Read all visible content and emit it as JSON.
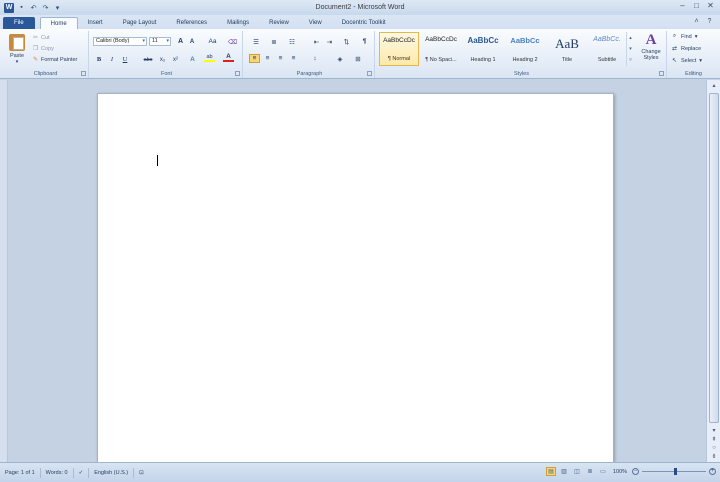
{
  "window": {
    "title": "Document2 - Microsoft Word",
    "logo_letter": "W",
    "controls": [
      "–",
      "□",
      "✕"
    ]
  },
  "qat": {
    "save_icon": "save-icon",
    "undo_icon": "undo-icon",
    "redo_icon": "redo-icon",
    "customize_icon": "chevron-down-icon"
  },
  "tabs": [
    {
      "label": "File"
    },
    {
      "label": "Home"
    },
    {
      "label": "Insert"
    },
    {
      "label": "Page Layout"
    },
    {
      "label": "References"
    },
    {
      "label": "Mailings"
    },
    {
      "label": "Review"
    },
    {
      "label": "View"
    },
    {
      "label": "Docentric Toolkit"
    }
  ],
  "clipboard": {
    "label": "Clipboard",
    "paste": "Paste",
    "cut": "Cut",
    "copy": "Copy",
    "format_painter": "Format Painter"
  },
  "font": {
    "label": "Font",
    "name": "Calibri (Body)",
    "size": "11",
    "grow": "A",
    "shrink": "A",
    "change_case": "Aa",
    "bold": "B",
    "italic": "I",
    "underline": "U",
    "strike": "abc",
    "subscript": "x₂",
    "superscript": "x²",
    "effects": "A",
    "highlight": "ab",
    "color": "A"
  },
  "paragraph": {
    "label": "Paragraph",
    "pilcrow": "¶"
  },
  "styles": {
    "label": "Styles",
    "items": [
      {
        "sample": "AaBbCcDc",
        "name": "¶ Normal"
      },
      {
        "sample": "AaBbCcDc",
        "name": "¶ No Spaci..."
      },
      {
        "sample": "AaBbCc",
        "name": "Heading 1"
      },
      {
        "sample": "AaBbCc",
        "name": "Heading 2"
      },
      {
        "sample": "AaB",
        "name": "Title"
      },
      {
        "sample": "AaBbCc.",
        "name": "Subtitle"
      }
    ],
    "change_styles": "Change Styles",
    "change_styles_glyph": "A"
  },
  "editing": {
    "label": "Editing",
    "find": "Find",
    "replace": "Replace",
    "select": "Select"
  },
  "status": {
    "page": "Page: 1 of 1",
    "words": "Words: 0",
    "language": "English (U.S.)",
    "zoom": "100%",
    "zoom_out": "−",
    "zoom_in": "+"
  },
  "colors": {
    "file_tab": "#2a579a",
    "accent": "#fbd77a",
    "highlight_swatch": "#ffff00",
    "font_color_swatch": "#e0201b"
  }
}
